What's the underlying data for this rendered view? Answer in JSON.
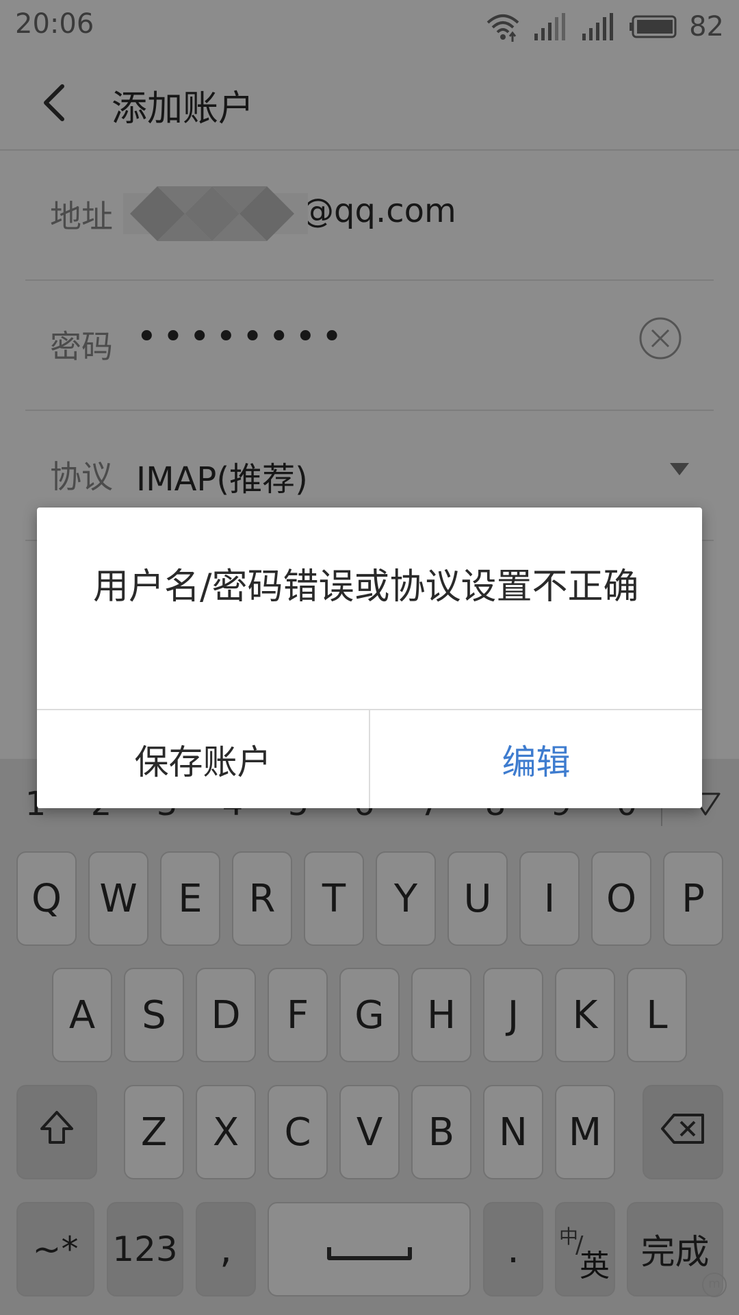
{
  "status_bar": {
    "time": "20:06",
    "battery": "82"
  },
  "app_bar": {
    "title": "添加账户"
  },
  "form": {
    "address": {
      "label": "地址",
      "value": "@qq.com"
    },
    "password": {
      "label": "密码",
      "value": "••••••••"
    },
    "protocol": {
      "label": "协议",
      "value": "IMAP(推荐)"
    }
  },
  "keyboard": {
    "numbers": [
      "1",
      "2",
      "3",
      "4",
      "5",
      "6",
      "7",
      "8",
      "9",
      "0"
    ],
    "row1": [
      "Q",
      "W",
      "E",
      "R",
      "T",
      "Y",
      "U",
      "I",
      "O",
      "P"
    ],
    "row2": [
      "A",
      "S",
      "D",
      "F",
      "G",
      "H",
      "J",
      "K",
      "L"
    ],
    "row3": [
      "Z",
      "X",
      "C",
      "V",
      "B",
      "N",
      "M"
    ],
    "symbols_label": "~*",
    "numeric_label": "123",
    "comma_label": ",",
    "period_label": ".",
    "lang_zh": "中",
    "lang_slash": "/",
    "lang_en": "英",
    "done_label": "完成"
  },
  "dialog": {
    "message": "用户名/密码错误或协议设置不正确",
    "left_button": "保存账户",
    "right_button": "编辑"
  },
  "colors": {
    "accent": "#3e7ccf",
    "scrim": "rgba(0,0,0,0.45)"
  },
  "icons": [
    "wifi-icon",
    "signal-icon",
    "battery-icon",
    "back-icon",
    "clear-icon",
    "dropdown-icon",
    "shift-icon",
    "backspace-icon",
    "space-icon",
    "collapse-keyboard-icon"
  ]
}
